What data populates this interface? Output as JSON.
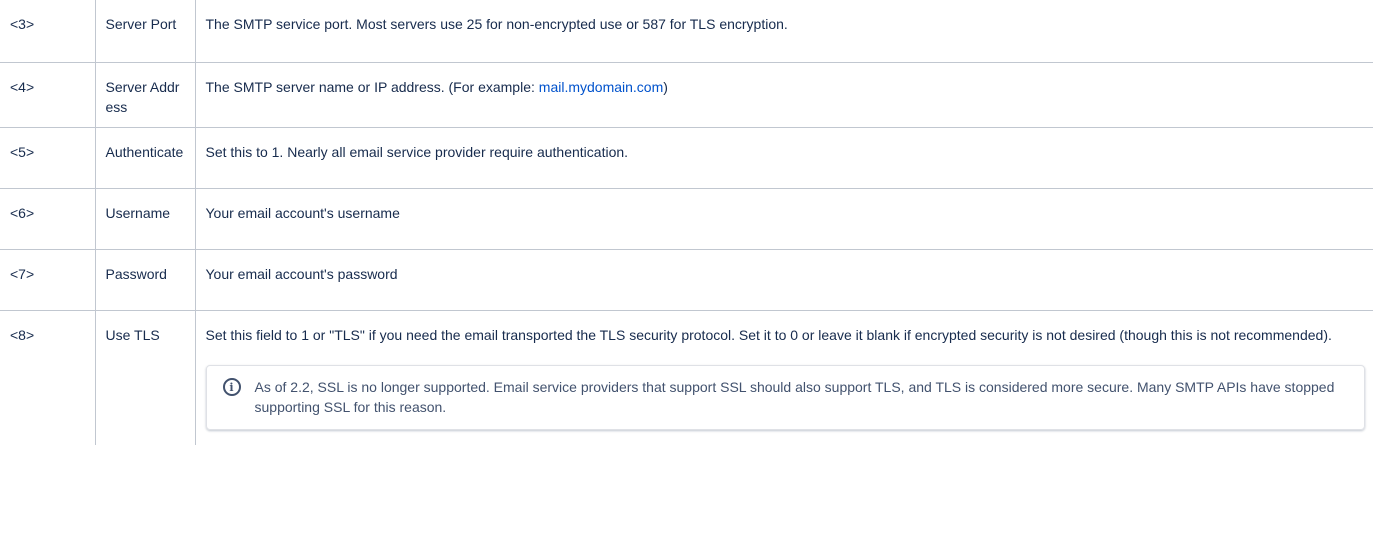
{
  "rows": [
    {
      "index": "<3>",
      "name": "Server Port",
      "description": "The SMTP service port. Most servers use 25 for non-encrypted use or 587 for TLS encryption."
    },
    {
      "index": "<4>",
      "name": "Server Address",
      "description_before": "The SMTP server name or IP address. (For example: ",
      "link_text": "mail.mydomain.com",
      "description_after": ")"
    },
    {
      "index": "<5>",
      "name": "Authenticate",
      "description": "Set this to 1. Nearly all email service provider require authentication."
    },
    {
      "index": "<6>",
      "name": "Username",
      "description": "Your email account's username"
    },
    {
      "index": "<7>",
      "name": "Password",
      "description": "Your email account's password"
    },
    {
      "index": "<8>",
      "name": "Use TLS",
      "description": "Set this field to 1 or \"TLS\" if you need the email transported the TLS security protocol. Set it to 0 or leave it blank if encrypted security is not desired (though this is not recommended).",
      "info_panel": {
        "icon": "info-icon",
        "icon_glyph": "i",
        "text": "As of 2.2, SSL is no longer supported. Email service providers that support SSL should also support TLS, and TLS is considered more secure. Many SMTP APIs have stopped supporting SSL for this reason."
      }
    }
  ],
  "colors": {
    "text": "#172b4d",
    "border": "#c1c7d0",
    "link": "#0052cc",
    "panel_text": "#42526e"
  }
}
